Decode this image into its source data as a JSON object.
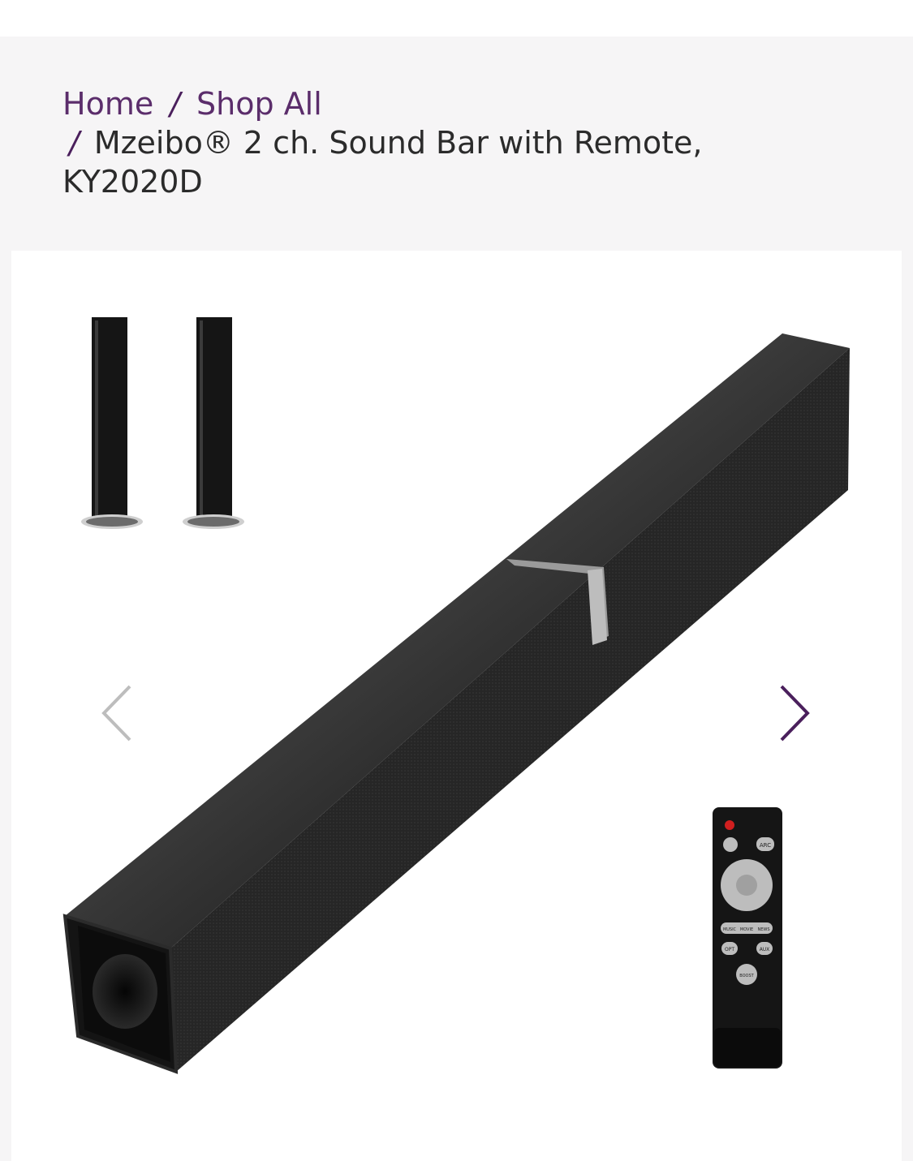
{
  "breadcrumb": {
    "home": "Home",
    "shop_all": "Shop All",
    "current_line1": "Mzeibo® 2 ch. Sound Bar with Remote,",
    "current_line2": "KY2020D",
    "separator": "/"
  },
  "gallery": {
    "prev_icon": "chevron-left-icon",
    "next_icon": "chevron-right-icon",
    "remote_labels": {
      "arc": "ARC",
      "music": "MUSIC",
      "movie": "MOVIE",
      "news": "NEWS",
      "opt": "OPT",
      "aux": "AUX",
      "boost": "BOOST"
    }
  },
  "colors": {
    "link": "#5b2d6b",
    "separator": "#4a1f5c",
    "background": "#f6f5f6"
  }
}
